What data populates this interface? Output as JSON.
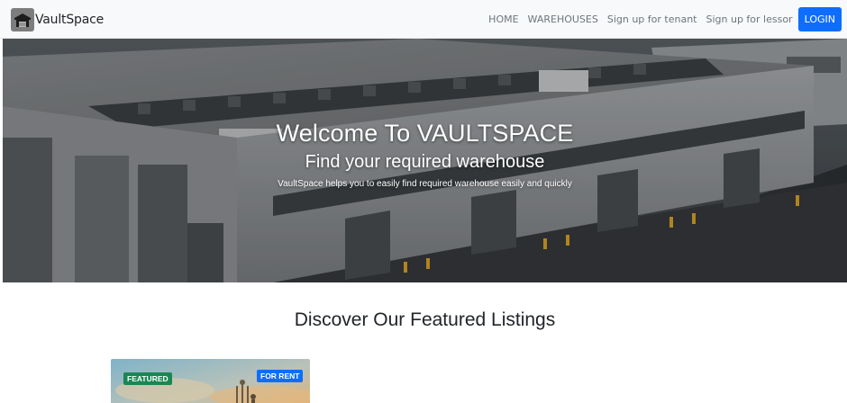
{
  "navbar": {
    "brand": "VaultSpace",
    "logo_icon": "warehouse-logo-icon",
    "links": [
      "HOME",
      "WAREHOUSES",
      "Sign up for tenant",
      "Sign up for lessor"
    ],
    "login_label": "LOGIN"
  },
  "hero": {
    "title": "Welcome To VAULTSPACE",
    "subtitle": "Find your required warehouse",
    "description": "VaultSpace helps you to easily find required warehouse easily and quickly"
  },
  "featured": {
    "title": "Discover Our Featured Listings",
    "cards": [
      {
        "badge_featured": "FEATURED",
        "badge_status": "FOR RENT"
      }
    ]
  },
  "colors": {
    "primary": "#0d6efd",
    "featured_badge": "#198754",
    "navbar_bg": "#f8f9fa"
  }
}
